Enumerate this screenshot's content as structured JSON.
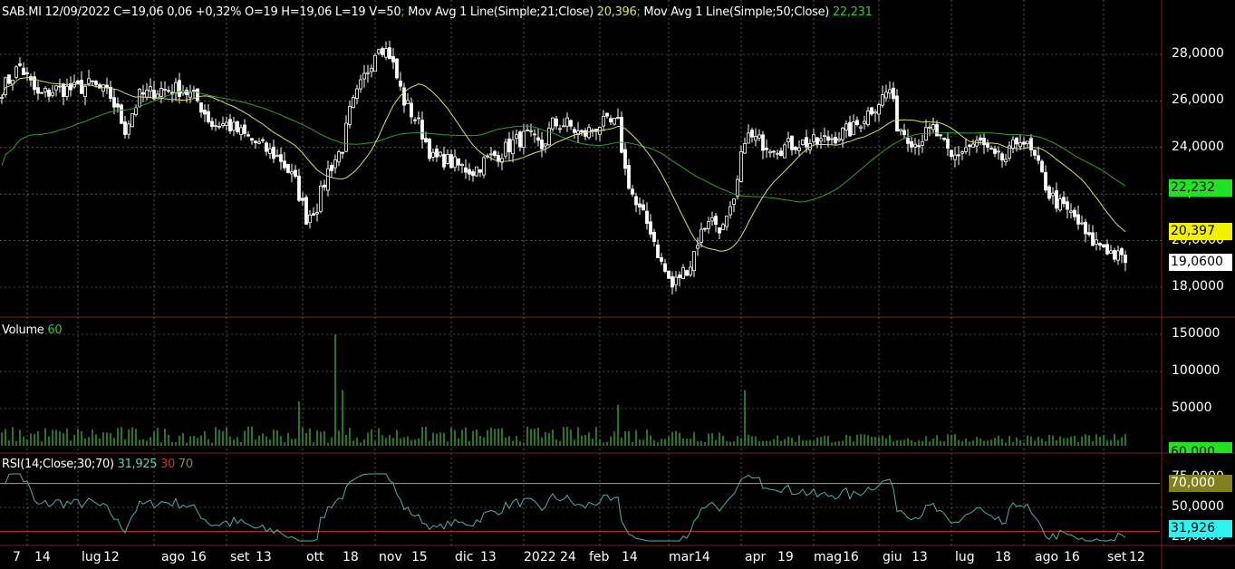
{
  "header": {
    "symbol_info": "SAB.MI 12/09/2022 C=19,06 0,06 +0,32% O=19 H=19,06 L=19 V=50",
    "ma21_label": "Mov Avg 1 Line(Simple;21;Close)",
    "ma21_value": "20,396",
    "ma50_label": "Mov Avg 1 Line(Simple;50;Close)",
    "ma50_value": "22,231",
    "sep": ";"
  },
  "volume_legend": {
    "label": "Volume",
    "value": "60"
  },
  "rsi_legend": {
    "label": "RSI(14;Close;30;70)",
    "value": "31,925",
    "low": "30",
    "high": "70"
  },
  "price_tags": {
    "ma50": "22,232",
    "ma21": "20,397",
    "last": "19,0600",
    "volume": "60,000",
    "rsi_high": "70,000",
    "rsi": "31,926"
  },
  "colors": {
    "ma21": "#d8e070",
    "ma50": "#2fa02f",
    "volume": "#3fc23f",
    "rsi": "#4fb0a8",
    "rsi_low": "#c03030",
    "rsi_high": "#8a8a40",
    "grid": "#8a8a8a",
    "separator": "#7a1f1f"
  },
  "chart_data": {
    "type": "candlestick",
    "price_axis": {
      "ticks": [
        "28,0000",
        "26,0000",
        "24,0000",
        "22,0000",
        "20,0000",
        "18,0000"
      ],
      "values": [
        28,
        26,
        24,
        22,
        20,
        18
      ],
      "range": [
        16.6,
        30.3
      ]
    },
    "volume_axis": {
      "ticks": [
        "150000",
        "100000",
        "50000"
      ],
      "values": [
        150000,
        100000,
        50000
      ],
      "range": [
        0,
        175000
      ]
    },
    "rsi_axis": {
      "ticks": [
        "75,0000",
        "50,0000",
        "25,0000"
      ],
      "values": [
        75,
        50,
        25
      ],
      "levels": [
        30,
        70
      ]
    },
    "x_labels": [
      "7",
      "14",
      "lug",
      "12",
      "ago",
      "16",
      "set",
      "13",
      "ott",
      "18",
      "nov",
      "15",
      "dic",
      "13",
      "2022",
      "24",
      "feb",
      "14",
      "mar",
      "14",
      "apr",
      "19",
      "mag",
      "16",
      "giu",
      "13",
      "lug",
      "18",
      "ago",
      "16",
      "set",
      "12"
    ],
    "x_label_days": [
      5,
      11,
      24,
      30,
      46,
      54,
      65,
      72,
      86,
      96,
      106,
      115,
      127,
      134,
      146,
      156,
      164,
      173,
      186,
      193,
      207,
      216,
      226,
      234,
      245,
      253,
      265,
      276,
      287,
      295,
      307,
      313
    ],
    "gridline_days": [
      7,
      21,
      42,
      62,
      83,
      103,
      124,
      144,
      165,
      184,
      204,
      224,
      242,
      262,
      282,
      304
    ],
    "close_points": [
      [
        0,
        26.5
      ],
      [
        5,
        27.5
      ],
      [
        10,
        26.2
      ],
      [
        15,
        26.5
      ],
      [
        20,
        26.5
      ],
      [
        25,
        26.7
      ],
      [
        30,
        26.2
      ],
      [
        34,
        24.8
      ],
      [
        38,
        26.2
      ],
      [
        44,
        26.5
      ],
      [
        50,
        26.5
      ],
      [
        54,
        26.0
      ],
      [
        58,
        25.0
      ],
      [
        62,
        25.0
      ],
      [
        67,
        24.5
      ],
      [
        72,
        24.0
      ],
      [
        77,
        23.5
      ],
      [
        81,
        22.5
      ],
      [
        84,
        21.0
      ],
      [
        87,
        21.5
      ],
      [
        90,
        23.0
      ],
      [
        94,
        24.0
      ],
      [
        96,
        25.5
      ],
      [
        100,
        27.0
      ],
      [
        104,
        28.5
      ],
      [
        107,
        28.0
      ],
      [
        111,
        26.0
      ],
      [
        115,
        25.0
      ],
      [
        119,
        23.5
      ],
      [
        122,
        23.5
      ],
      [
        126,
        23.2
      ],
      [
        130,
        23.0
      ],
      [
        134,
        23.5
      ],
      [
        138,
        23.8
      ],
      [
        141,
        24.2
      ],
      [
        145,
        24.5
      ],
      [
        149,
        24.0
      ],
      [
        152,
        25.0
      ],
      [
        156,
        25.0
      ],
      [
        160,
        24.5
      ],
      [
        165,
        25.0
      ],
      [
        170,
        25.0
      ],
      [
        172,
        23.0
      ],
      [
        175,
        21.5
      ],
      [
        179,
        20.5
      ],
      [
        182,
        19.0
      ],
      [
        185,
        18.0
      ],
      [
        187,
        18.5
      ],
      [
        190,
        19.0
      ],
      [
        192,
        20.0
      ],
      [
        195,
        21.0
      ],
      [
        199,
        20.5
      ],
      [
        202,
        21.5
      ],
      [
        205,
        24.5
      ],
      [
        210,
        24.2
      ],
      [
        215,
        24.0
      ],
      [
        220,
        24.2
      ],
      [
        225,
        24.2
      ],
      [
        230,
        24.5
      ],
      [
        235,
        24.8
      ],
      [
        239,
        25.5
      ],
      [
        242,
        26.0
      ],
      [
        245,
        26.5
      ],
      [
        247,
        25.0
      ],
      [
        252,
        24.2
      ],
      [
        257,
        24.8
      ],
      [
        262,
        23.5
      ],
      [
        266,
        24.0
      ],
      [
        270,
        24.2
      ],
      [
        274,
        23.5
      ],
      [
        277,
        23.5
      ],
      [
        281,
        24.5
      ],
      [
        285,
        23.5
      ],
      [
        289,
        22.0
      ],
      [
        292,
        21.5
      ],
      [
        296,
        21.0
      ],
      [
        300,
        20.0
      ],
      [
        304,
        19.8
      ],
      [
        306,
        19.5
      ],
      [
        310,
        19.06
      ]
    ],
    "volume_spikes": [
      [
        82,
        60000
      ],
      [
        92,
        150000
      ],
      [
        94,
        75000
      ],
      [
        170,
        55000
      ],
      [
        205,
        75000
      ]
    ],
    "moving_averages": [
      {
        "name": "MA 21",
        "last": 20.396
      },
      {
        "name": "MA 50",
        "last": 22.231
      }
    ],
    "last_close": 19.06
  }
}
